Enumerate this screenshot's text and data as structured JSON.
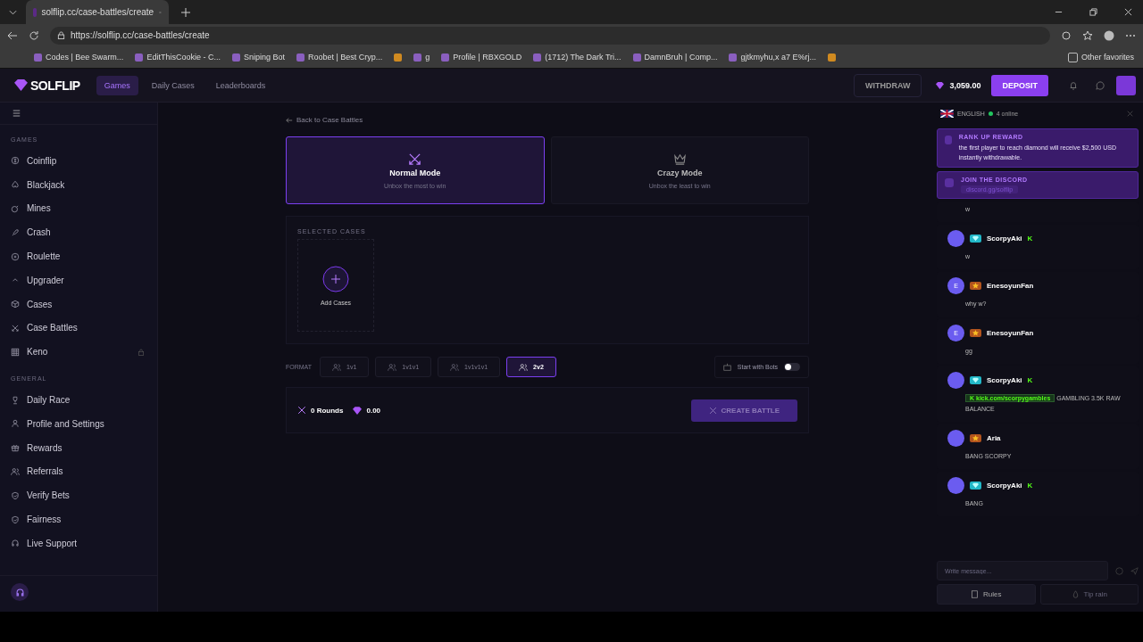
{
  "browser": {
    "tab_title": "solflip.cc/case-battles/create",
    "url": "https://solflip.cc/case-battles/create",
    "bookmarks": [
      {
        "kind": "link",
        "label": "Codes | Bee Swarm..."
      },
      {
        "kind": "link",
        "label": "EditThisCookie - C..."
      },
      {
        "kind": "link",
        "label": "Sniping Bot"
      },
      {
        "kind": "link",
        "label": "Roobet | Best Cryp..."
      },
      {
        "kind": "icon"
      },
      {
        "kind": "link",
        "label": "g"
      },
      {
        "kind": "link",
        "label": "Profile | RBXGOLD"
      },
      {
        "kind": "link",
        "label": "(1712) The Dark Tri..."
      },
      {
        "kind": "link",
        "label": "DamnBruh | Comp..."
      },
      {
        "kind": "link",
        "label": "gjtkmyhu,x a7 E%rj..."
      },
      {
        "kind": "icon"
      }
    ],
    "other_favorites": "Other favorites"
  },
  "header": {
    "logo": "SOLFLIP",
    "nav": [
      {
        "label": "Games",
        "selected": true
      },
      {
        "label": "Daily Cases",
        "selected": false
      },
      {
        "label": "Leaderboards",
        "selected": false
      }
    ],
    "withdraw": "WITHDRAW",
    "balance": "3,059.00",
    "deposit": "DEPOSIT"
  },
  "sidebar": {
    "sections": [
      {
        "title": "GAMES",
        "items": [
          {
            "label": "Coinflip",
            "locked": false
          },
          {
            "label": "Blackjack",
            "locked": false
          },
          {
            "label": "Mines",
            "locked": false
          },
          {
            "label": "Crash",
            "locked": false
          },
          {
            "label": "Roulette",
            "locked": false
          },
          {
            "label": "Upgrader",
            "locked": false
          },
          {
            "label": "Cases",
            "locked": false
          },
          {
            "label": "Case Battles",
            "locked": false
          },
          {
            "label": "Keno",
            "locked": true
          }
        ]
      },
      {
        "title": "GENERAL",
        "items": [
          {
            "label": "Daily Race",
            "locked": false
          },
          {
            "label": "Profile and Settings",
            "locked": false
          },
          {
            "label": "Rewards",
            "locked": false
          },
          {
            "label": "Referrals",
            "locked": false
          },
          {
            "label": "Verify Bets",
            "locked": false
          },
          {
            "label": "Fairness",
            "locked": false
          },
          {
            "label": "Live Support",
            "locked": false
          }
        ]
      }
    ]
  },
  "main": {
    "back_link": "Back to Case Battles",
    "modes": [
      {
        "title": "Normal Mode",
        "subtitle": "Unbox the most to win",
        "selected": true
      },
      {
        "title": "Crazy Mode",
        "subtitle": "Unbox the least to win",
        "selected": false
      }
    ],
    "selected_cases_label": "SELECTED CASES",
    "add_cases": "Add Cases",
    "format_label": "FORMAT",
    "formats": [
      {
        "label": "1v1",
        "selected": false
      },
      {
        "label": "1v1v1",
        "selected": false
      },
      {
        "label": "1v1v1v1",
        "selected": false
      },
      {
        "label": "2v2",
        "selected": true
      }
    ],
    "bots": {
      "label": "Start with Bots",
      "on": false
    },
    "rounds": "0 Rounds",
    "total": "0.00",
    "create_button": "CREATE BATTLE"
  },
  "chat": {
    "language": "ENGLISH",
    "online": "4 online",
    "announcements": [
      {
        "title": "RANK UP REWARD",
        "text": "the first player to reach diamond will receive $2,500 USD instantly withdrawable."
      },
      {
        "title": "JOIN THE DISCORD",
        "link": "discord.gg/solflip"
      }
    ],
    "messages": [
      {
        "kind": "partial",
        "text": "w"
      },
      {
        "kind": "full",
        "user": "ScorpyAki",
        "badge": {
          "kind": "diamond",
          "color": "#22b8c8"
        },
        "tag": "K",
        "text": "w"
      },
      {
        "kind": "full",
        "user": "EnesoyunFan",
        "avatar_letter": "E",
        "badge": {
          "kind": "star",
          "color": "#b3541e"
        },
        "text": "why w?"
      },
      {
        "kind": "full",
        "user": "EnesoyunFan",
        "avatar_letter": "E",
        "badge": {
          "kind": "star",
          "color": "#b3541e"
        },
        "text": "gg"
      },
      {
        "kind": "full",
        "user": "ScorpyAki",
        "badge": {
          "kind": "diamond",
          "color": "#22b8c8"
        },
        "tag": "K",
        "link_icon": "K",
        "link": "kick.com/scorpygambles",
        "text": "GAMBLING 3.5K RAW BALANCE"
      },
      {
        "kind": "full",
        "user": "Aria",
        "badge": {
          "kind": "star",
          "color": "#b3541e"
        },
        "text": "BANG SCORPY"
      },
      {
        "kind": "full",
        "user": "ScorpyAki",
        "badge": {
          "kind": "diamond",
          "color": "#22b8c8"
        },
        "tag": "K",
        "text": "BANG"
      }
    ],
    "placeholder": "Write message...",
    "rules": "Rules",
    "tip_rain": "Tip rain"
  }
}
